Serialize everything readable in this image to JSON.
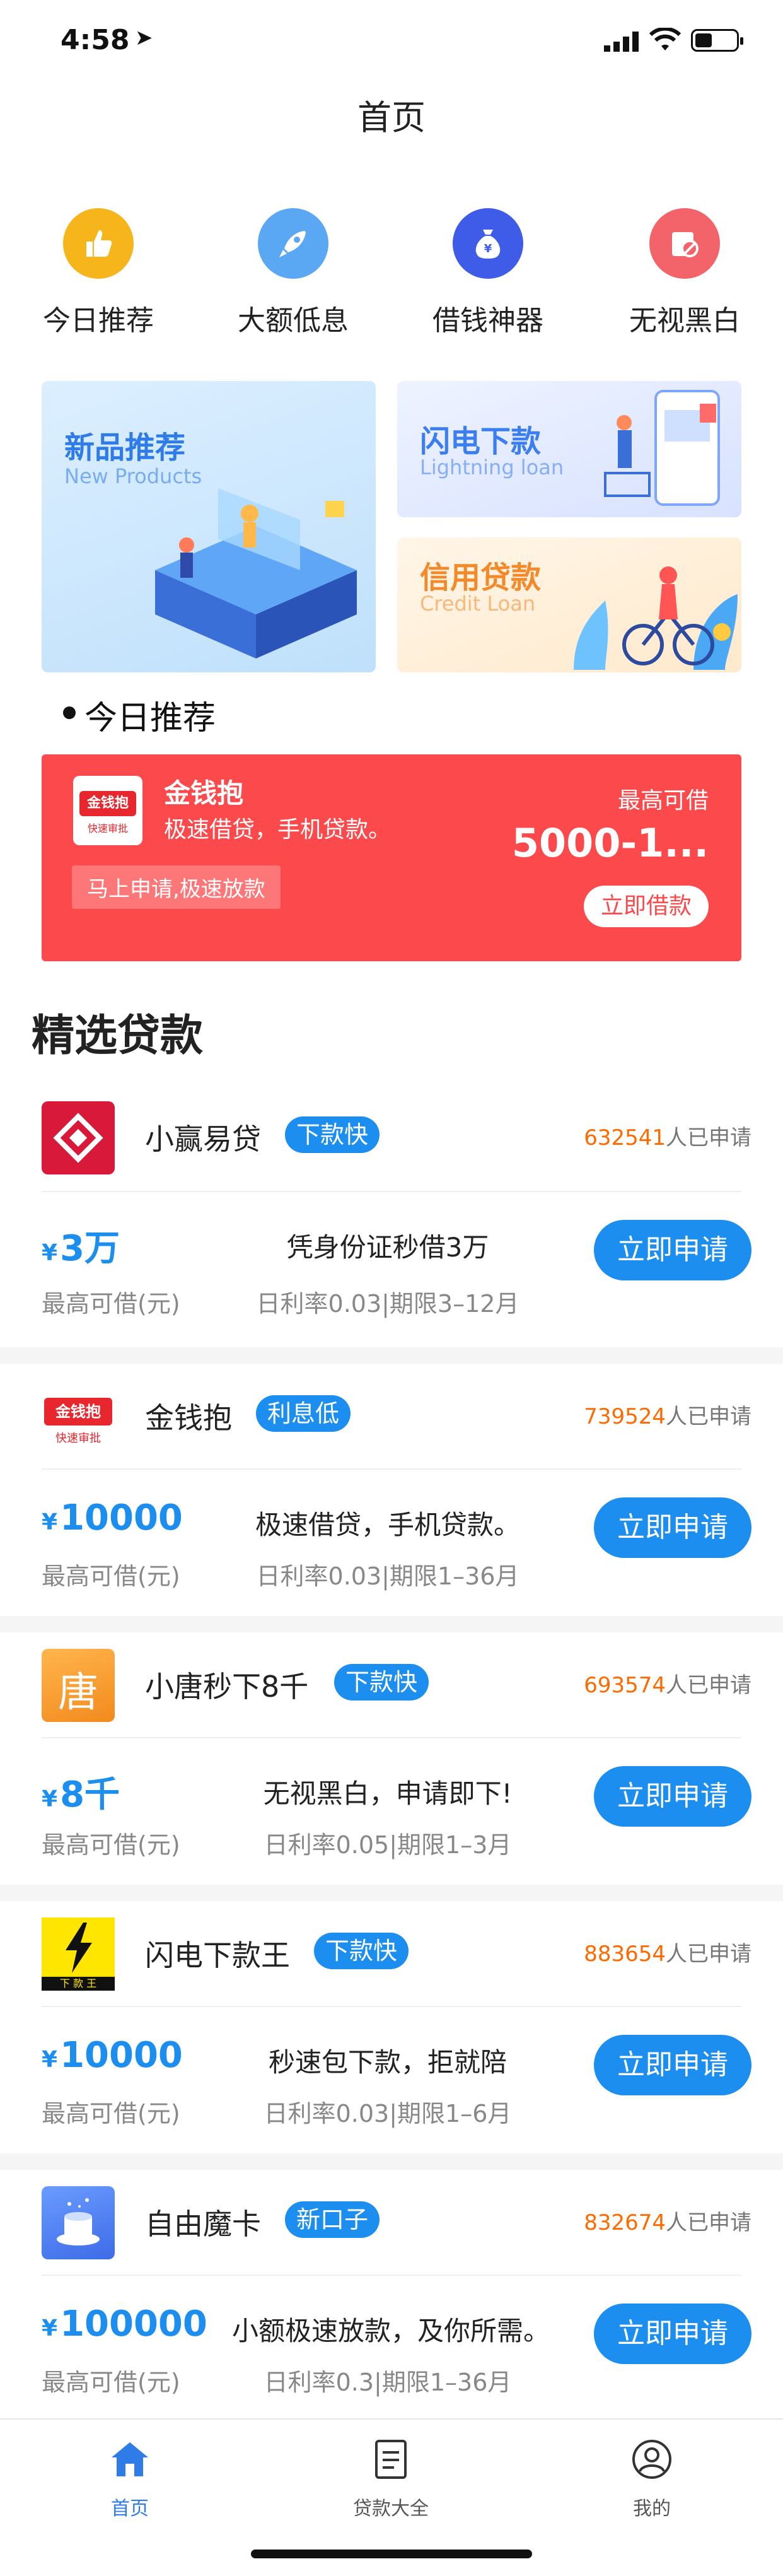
{
  "status": {
    "time": "4:58",
    "location_icon": "location-arrow-icon"
  },
  "header": {
    "title": "首页"
  },
  "quick_actions": [
    {
      "label": "今日推荐",
      "icon": "thumbs-up-icon",
      "color": "#f7b51c"
    },
    {
      "label": "大额低息",
      "icon": "rocket-icon",
      "color": "#5aa7f3"
    },
    {
      "label": "借钱神器",
      "icon": "money-bag-icon",
      "color": "#3e5ce8"
    },
    {
      "label": "无视黑白",
      "icon": "no-entry-card-icon",
      "color": "#f2636a"
    }
  ],
  "banners": {
    "new_products": {
      "title": "新品推荐",
      "subtitle": "New Products"
    },
    "lightning": {
      "title": "闪电下款",
      "subtitle": "Lightning loan"
    },
    "credit": {
      "title": "信用贷款",
      "subtitle": "Credit Loan"
    }
  },
  "today": {
    "heading": "今日推荐",
    "name": "金钱抱",
    "desc": "极速借贷，手机贷款。",
    "badge": "马上申请,极速放款",
    "max_label": "最高可借",
    "amount": "5000-1...",
    "button": "立即借款",
    "logo_text": "金钱抱",
    "logo_sub": "快速审批"
  },
  "featured_heading": "精选贷款",
  "loans": [
    {
      "name": "小赢易贷",
      "tag": "下款快",
      "count": "632541",
      "count_suffix": "人已申请",
      "currency": "¥",
      "amount": "3万",
      "max_label": "最高可借(元)",
      "desc": "凭身份证秒借3万",
      "rate": "日利率0.03|期限3–12月",
      "button": "立即申请"
    },
    {
      "name": "金钱抱",
      "tag": "利息低",
      "count": "739524",
      "count_suffix": "人已申请",
      "currency": "¥",
      "amount": "10000",
      "max_label": "最高可借(元)",
      "desc": "极速借贷，手机贷款。",
      "rate": "日利率0.03|期限1–36月",
      "button": "立即申请",
      "logo_text": "金钱抱",
      "logo_sub": "快速审批"
    },
    {
      "name": "小唐秒下8千",
      "tag": "下款快",
      "count": "693574",
      "count_suffix": "人已申请",
      "currency": "¥",
      "amount": "8千",
      "max_label": "最高可借(元)",
      "desc": "无视黑白，申请即下!",
      "rate": "日利率0.05|期限1–3月",
      "button": "立即申请",
      "logo_text": "唐"
    },
    {
      "name": "闪电下款王",
      "tag": "下款快",
      "count": "883654",
      "count_suffix": "人已申请",
      "currency": "¥",
      "amount": "10000",
      "max_label": "最高可借(元)",
      "desc": "秒速包下款，拒就陪",
      "rate": "日利率0.03|期限1–6月",
      "button": "立即申请",
      "logo_text": "下 款 王"
    },
    {
      "name": "自由魔卡",
      "tag": "新口子",
      "count": "832674",
      "count_suffix": "人已申请",
      "currency": "¥",
      "amount": "100000",
      "max_label": "最高可借(元)",
      "desc": "小额极速放款，及你所需。",
      "rate": "日利率0.3|期限1–36月",
      "button": "立即申请"
    }
  ],
  "tabs": [
    {
      "label": "首页",
      "icon": "home-icon",
      "active": true
    },
    {
      "label": "贷款大全",
      "icon": "document-list-icon",
      "active": false
    },
    {
      "label": "我的",
      "icon": "user-profile-icon",
      "active": false
    }
  ],
  "colors": {
    "accent": "#1c8ef0",
    "featured_red": "#fc4a4c",
    "count_orange": "#ff6a00"
  }
}
